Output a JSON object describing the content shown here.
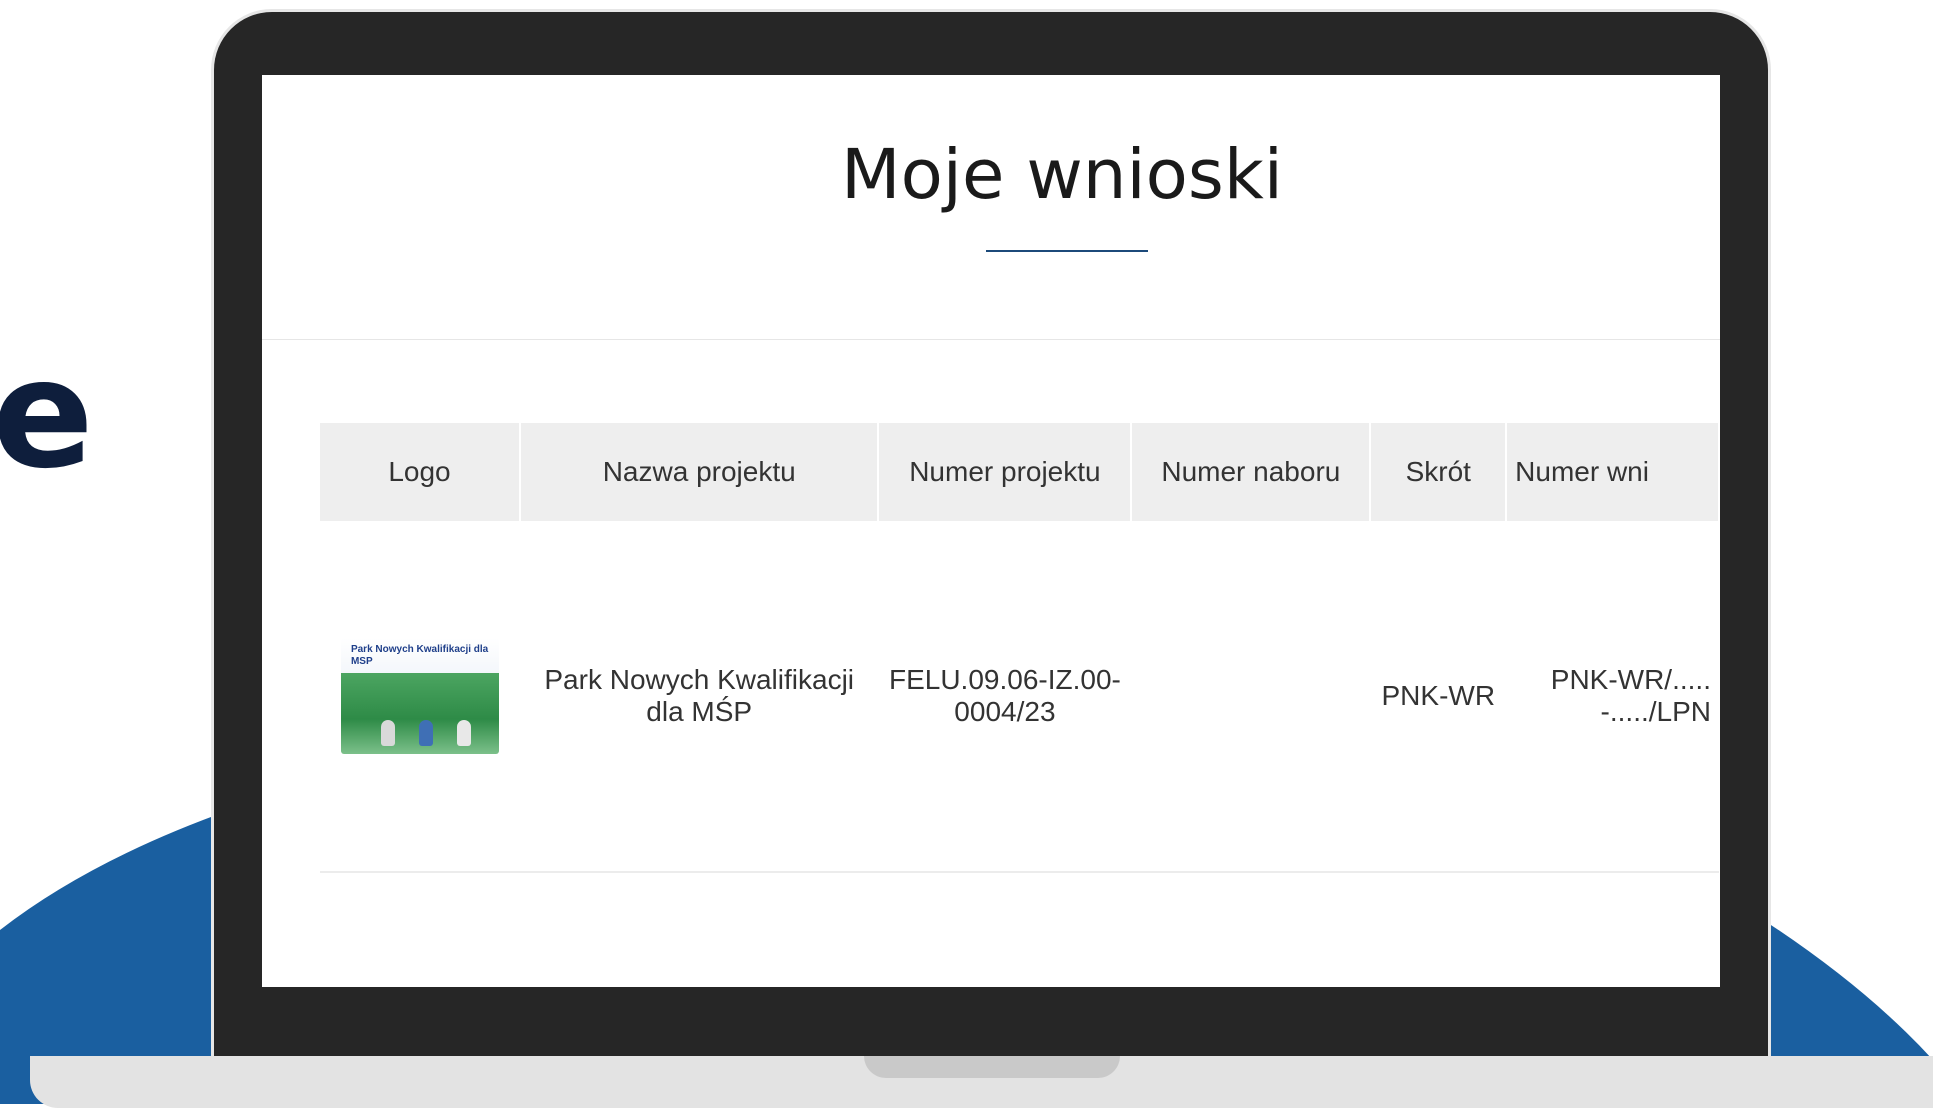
{
  "background": {
    "accent_color": "#1a5fa0",
    "letter": "e"
  },
  "page": {
    "title": "Moje wnioski"
  },
  "table": {
    "columns": [
      "Logo",
      "Nazwa projektu",
      "Numer projektu",
      "Numer naboru",
      "Skrót",
      "Numer wni"
    ],
    "rows": [
      {
        "logo_text": "Park Nowych Kwalifikacji dla MSP",
        "name": "Park Nowych Kwalifikacji dla MŚP",
        "project_number": "FELU.09.06-IZ.00-0004/23",
        "call_number": "",
        "abbreviation": "PNK-WR",
        "application_number": "PNK-WR/.....-...../LPN"
      }
    ]
  }
}
